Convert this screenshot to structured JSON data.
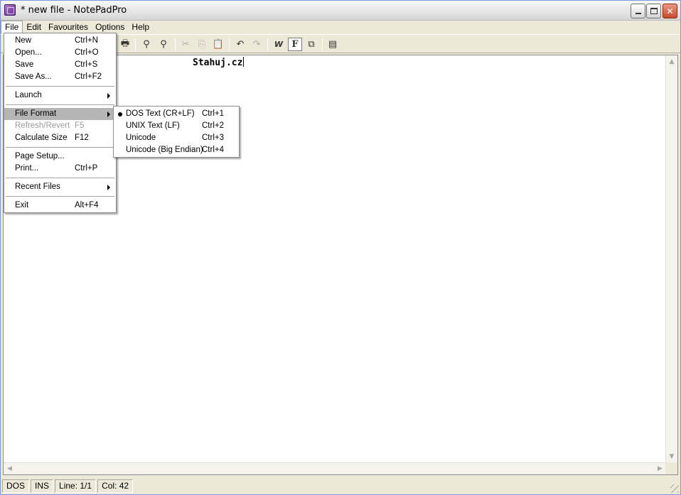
{
  "window": {
    "title": "* new file - NotePadPro"
  },
  "menubar": {
    "items": [
      "File",
      "Edit",
      "Favourites",
      "Options",
      "Help"
    ],
    "active": "File"
  },
  "file_menu": {
    "items": [
      {
        "label": "New",
        "shortcut": "Ctrl+N"
      },
      {
        "label": "Open...",
        "shortcut": "Ctrl+O"
      },
      {
        "label": "Save",
        "shortcut": "Ctrl+S"
      },
      {
        "label": "Save As...",
        "shortcut": "Ctrl+F2"
      },
      {
        "label": "Launch",
        "shortcut": ""
      },
      {
        "label": "File Format",
        "shortcut": ""
      },
      {
        "label": "Refresh/Revert",
        "shortcut": "F5"
      },
      {
        "label": "Calculate Size",
        "shortcut": "F12"
      },
      {
        "label": "Page Setup...",
        "shortcut": ""
      },
      {
        "label": "Print...",
        "shortcut": "Ctrl+P"
      },
      {
        "label": "Recent Files",
        "shortcut": ""
      },
      {
        "label": "Exit",
        "shortcut": "Alt+F4"
      }
    ]
  },
  "file_format_menu": {
    "items": [
      {
        "label": "DOS Text (CR+LF)",
        "shortcut": "Ctrl+1",
        "selected": true
      },
      {
        "label": "UNIX Text (LF)",
        "shortcut": "Ctrl+2",
        "selected": false
      },
      {
        "label": "Unicode",
        "shortcut": "Ctrl+3",
        "selected": false
      },
      {
        "label": "Unicode (Big Endian)",
        "shortcut": "Ctrl+4",
        "selected": false
      }
    ]
  },
  "toolbar": {
    "icons": [
      "print-icon",
      "find-icon",
      "replace-icon",
      "cut-icon",
      "copy-icon",
      "paste-icon",
      "undo-icon",
      "redo-icon",
      "word-wrap-icon",
      "font-icon",
      "fullscreen-icon",
      "properties-icon"
    ]
  },
  "editor": {
    "text": "Stahuj.cz"
  },
  "status": {
    "format": "DOS",
    "mode": "INS",
    "line": "Line: 1/1",
    "col": "Col: 42"
  }
}
